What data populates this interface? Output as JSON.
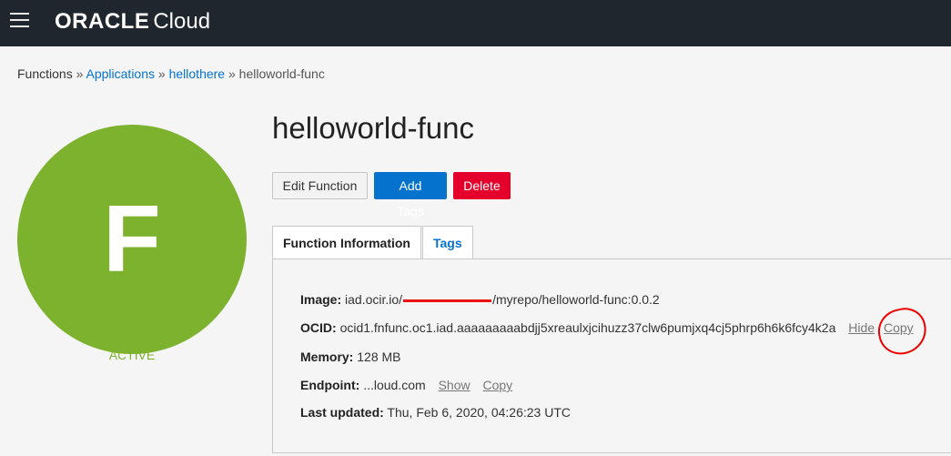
{
  "header": {
    "brand": "ORACLE",
    "product": "Cloud"
  },
  "breadcrumb": {
    "root": "Functions",
    "separator": "»",
    "applications": "Applications",
    "app": "hellothere",
    "current": "helloworld-func"
  },
  "avatar": {
    "letter": "F",
    "status": "ACTIVE",
    "color": "#7db22f"
  },
  "page": {
    "title": "helloworld-func"
  },
  "actions": {
    "edit": "Edit Function",
    "add_tags": "Add Tags",
    "delete": "Delete"
  },
  "tabs": {
    "info": "Function Information",
    "tags": "Tags"
  },
  "details": {
    "image_label": "Image:",
    "image_prefix": "iad.ocir.io/",
    "image_suffix": "/myrepo/helloworld-func:0.0.2",
    "ocid_label": "OCID:",
    "ocid_value": "ocid1.fnfunc.oc1.iad.aaaaaaaaabdjj5xreaulxjcihuzz37clw6pumjxq4cj5phrp6h6k6fcy4k2a",
    "ocid_hide": "Hide",
    "ocid_copy": "Copy",
    "memory_label": "Memory:",
    "memory_value": "128 MB",
    "endpoint_label": "Endpoint:",
    "endpoint_value": "...loud.com",
    "endpoint_show": "Show",
    "endpoint_copy": "Copy",
    "updated_label": "Last updated:",
    "updated_value": "Thu, Feb 6, 2020, 04:26:23 UTC"
  },
  "colors": {
    "topbar": "#20262e",
    "primary": "#0572ce",
    "danger": "#e4002b",
    "annotation": "#ee0000"
  }
}
